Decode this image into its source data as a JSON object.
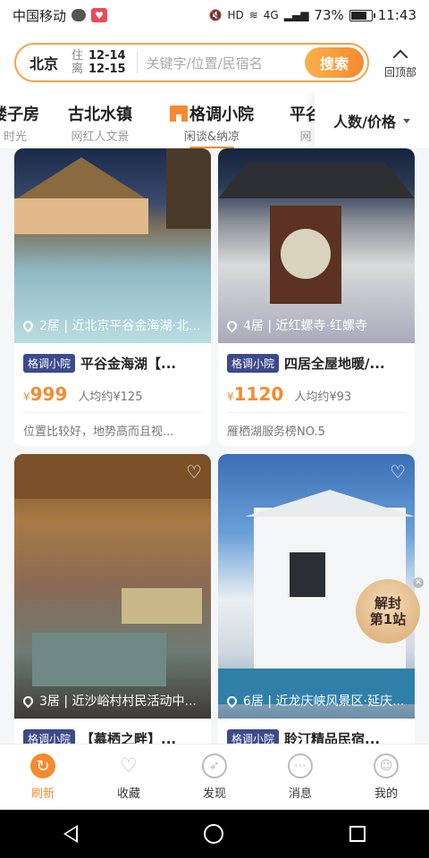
{
  "status_bar": {
    "carrier": "中国移动",
    "network": "4G",
    "battery": "73%",
    "battery_level": 0.73,
    "time": "11:43",
    "hd": "HD"
  },
  "search": {
    "city": "北京",
    "checkin_label": "住",
    "checkin_date": "12-14",
    "checkout_label": "离",
    "checkout_date": "12-15",
    "placeholder": "关键字/位置/民宿名",
    "button_label": "搜索"
  },
  "back_to_top": {
    "label": "回顶部"
  },
  "tabs": [
    {
      "title": "楼子房",
      "subtitle": "时光"
    },
    {
      "title": "古北水镇",
      "subtitle": "网红人文景"
    },
    {
      "title": "格调小院",
      "subtitle": "闲谈&纳凉",
      "active": true
    },
    {
      "title": "平谷",
      "subtitle": "网"
    }
  ],
  "filter": {
    "label": "人数/价格"
  },
  "listings": [
    {
      "location": "2居 | 近北京平谷金海湖·北...",
      "tag": "格调小院",
      "title": "平谷金海湖【...",
      "price_symbol": "¥",
      "price": "999",
      "avg": "人均约¥125",
      "desc": "位置比较好，地势高而且视..."
    },
    {
      "location": "4居 | 近红螺寺·红螺寺",
      "tag": "格调小院",
      "title": "四居全屋地暖/...",
      "price_symbol": "¥",
      "price": "1120",
      "avg": "人均约¥93",
      "desc": "雁栖湖服务榜NO.5"
    },
    {
      "location": "3居 | 近沙峪村村民活动中...",
      "tag": "格调小院",
      "title": "【慕栖之畔】...",
      "price_symbol": "",
      "price": "",
      "avg": "",
      "desc": ""
    },
    {
      "location": "6居 | 近龙庆峡风景区·延庆...",
      "tag": "格调小院",
      "title": "聆汀精品民宿...",
      "price_symbol": "",
      "price": "",
      "avg": "",
      "desc": ""
    }
  ],
  "promo_badge": {
    "line1": "解封",
    "line2": "第1站"
  },
  "bottom_tabs": [
    {
      "label": "刷新",
      "icon": "refresh-icon",
      "active": true
    },
    {
      "label": "收藏",
      "icon": "heart-icon"
    },
    {
      "label": "发现",
      "icon": "compass-icon"
    },
    {
      "label": "消息",
      "icon": "message-icon"
    },
    {
      "label": "我的",
      "icon": "profile-icon"
    }
  ],
  "colors": {
    "accent": "#f58a2e",
    "tag_bg": "#3b4a8c",
    "search_border": "#f7a24a"
  }
}
